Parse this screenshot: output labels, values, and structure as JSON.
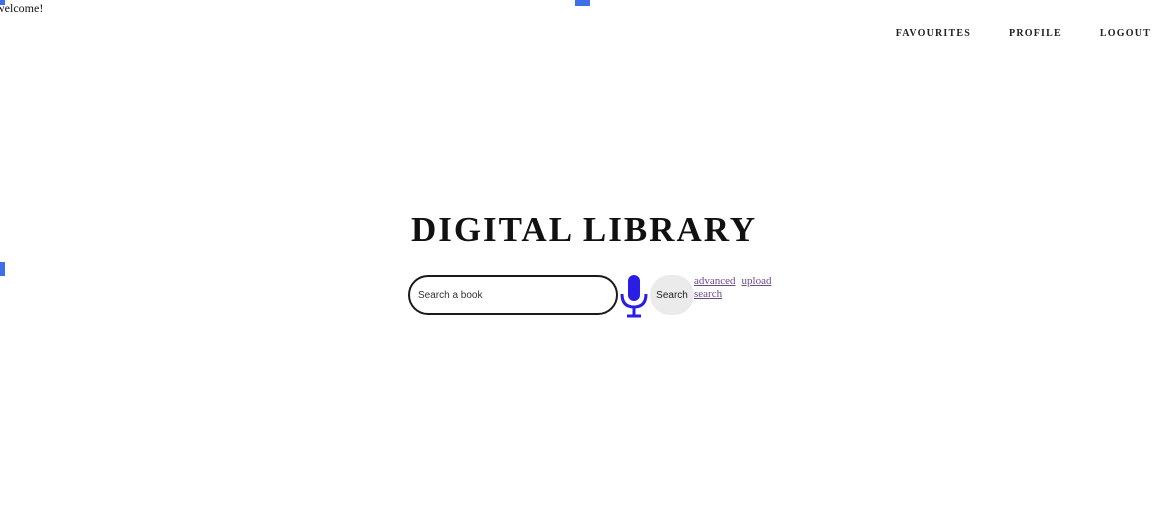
{
  "welcome_text": "welcome!",
  "nav": {
    "items": [
      {
        "label": "FAVOURITES"
      },
      {
        "label": "PROFILE"
      },
      {
        "label": "LOGOUT"
      }
    ]
  },
  "title": "DIGITAL LIBRARY",
  "search": {
    "placeholder": "Search a book",
    "value": "",
    "mic_icon": "microphone-icon",
    "button_label": "Search"
  },
  "links": {
    "advanced_1": "advanced",
    "advanced_2": "search",
    "upload": "upload"
  },
  "colors": {
    "mic": "#2a1ee6",
    "link": "#6a4a8a",
    "marker": "#3f6fe8",
    "button_bg": "#ebebeb"
  }
}
